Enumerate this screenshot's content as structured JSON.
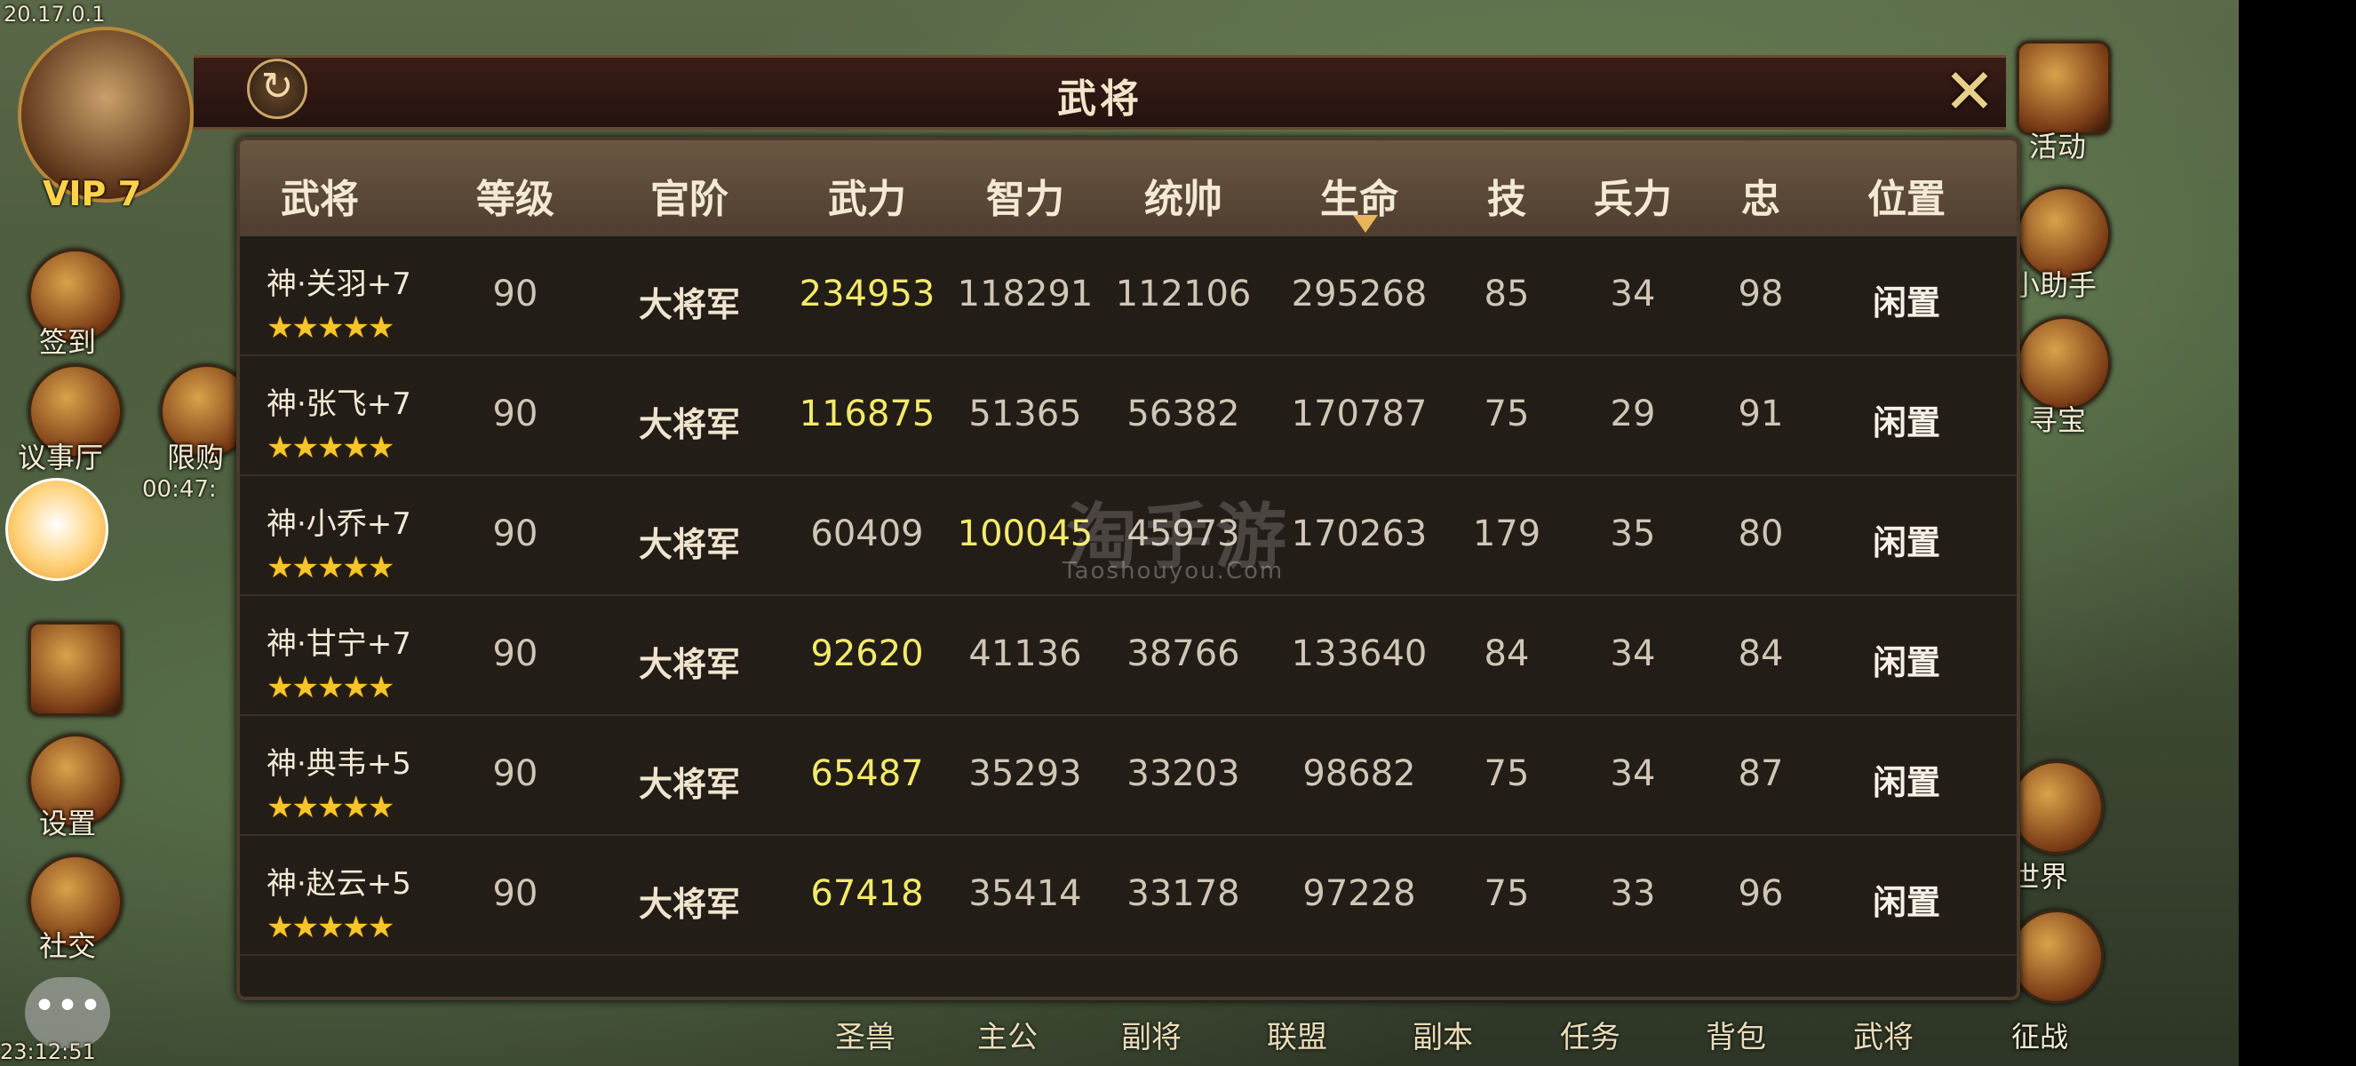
{
  "hud": {
    "ip": "20.17.0.1",
    "vip": "VIP 7",
    "timer": "00:47:",
    "clock": "23:12:51",
    "left_labels": [
      "签到",
      "议事厅",
      "限购",
      "设置",
      "社交"
    ],
    "right_labels": [
      "活动",
      "小助手",
      "寻宝",
      "世界",
      "征战"
    ],
    "bottom_menu": [
      "圣兽",
      "主公",
      "副将",
      "联盟",
      "副本",
      "任务",
      "背包",
      "武将"
    ]
  },
  "modal": {
    "title": "武将",
    "refresh_icon": "refresh-icon",
    "close_icon": "close-icon"
  },
  "table": {
    "columns": [
      "武将",
      "等级",
      "官阶",
      "武力",
      "智力",
      "统帅",
      "生命",
      "技",
      "兵力",
      "忠",
      "位置"
    ],
    "sorted_by": "生命",
    "rows": [
      {
        "name": "神·关羽+7",
        "stars": "★★★★★",
        "level": "90",
        "rank": "大将军",
        "force": "234953",
        "intel": "118291",
        "command": "112106",
        "hp": "295268",
        "skill": "85",
        "troops": "34",
        "loyalty": "98",
        "position": "闲置",
        "highlight": "force"
      },
      {
        "name": "神·张飞+7",
        "stars": "★★★★★",
        "level": "90",
        "rank": "大将军",
        "force": "116875",
        "intel": "51365",
        "command": "56382",
        "hp": "170787",
        "skill": "75",
        "troops": "29",
        "loyalty": "91",
        "position": "闲置",
        "highlight": "force"
      },
      {
        "name": "神·小乔+7",
        "stars": "★★★★★",
        "level": "90",
        "rank": "大将军",
        "force": "60409",
        "intel": "100045",
        "command": "45973",
        "hp": "170263",
        "skill": "179",
        "troops": "35",
        "loyalty": "80",
        "position": "闲置",
        "highlight": "intel"
      },
      {
        "name": "神·甘宁+7",
        "stars": "★★★★★",
        "level": "90",
        "rank": "大将军",
        "force": "92620",
        "intel": "41136",
        "command": "38766",
        "hp": "133640",
        "skill": "84",
        "troops": "34",
        "loyalty": "84",
        "position": "闲置",
        "highlight": "force"
      },
      {
        "name": "神·典韦+5",
        "stars": "★★★★★",
        "level": "90",
        "rank": "大将军",
        "force": "65487",
        "intel": "35293",
        "command": "33203",
        "hp": "98682",
        "skill": "75",
        "troops": "34",
        "loyalty": "87",
        "position": "闲置",
        "highlight": "force"
      },
      {
        "name": "神·赵云+5",
        "stars": "★★★★★",
        "level": "90",
        "rank": "大将军",
        "force": "67418",
        "intel": "35414",
        "command": "33178",
        "hp": "97228",
        "skill": "75",
        "troops": "33",
        "loyalty": "96",
        "position": "闲置",
        "highlight": "force"
      }
    ]
  },
  "watermark": {
    "main": "淘手游",
    "sub": "Taoshouyou.Com"
  }
}
